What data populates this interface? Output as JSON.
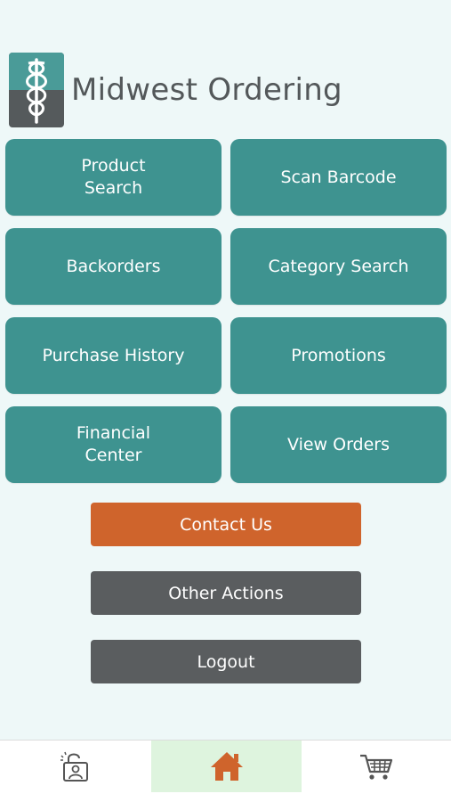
{
  "app": {
    "title": "Midwest Ordering"
  },
  "tiles": [
    {
      "label": "Product\nSearch"
    },
    {
      "label": "Scan Barcode"
    },
    {
      "label": "Backorders"
    },
    {
      "label": "Category Search"
    },
    {
      "label": "Purchase History"
    },
    {
      "label": "Promotions"
    },
    {
      "label": "Financial\nCenter"
    },
    {
      "label": "View Orders"
    }
  ],
  "actions": {
    "contact_label": "Contact Us",
    "other_label": "Other Actions",
    "logout_label": "Logout"
  },
  "tabbar": {
    "tabs": [
      {
        "icon": "account-lock-icon",
        "active": false
      },
      {
        "icon": "home-icon",
        "active": true
      },
      {
        "icon": "cart-icon",
        "active": false
      }
    ]
  },
  "colors": {
    "tile": "#3e9390",
    "contact": "#cf642c",
    "neutral_button": "#5a5d5f",
    "active_tab": "#def4de",
    "home_icon": "#cf642c",
    "background": "#eef8f8"
  }
}
